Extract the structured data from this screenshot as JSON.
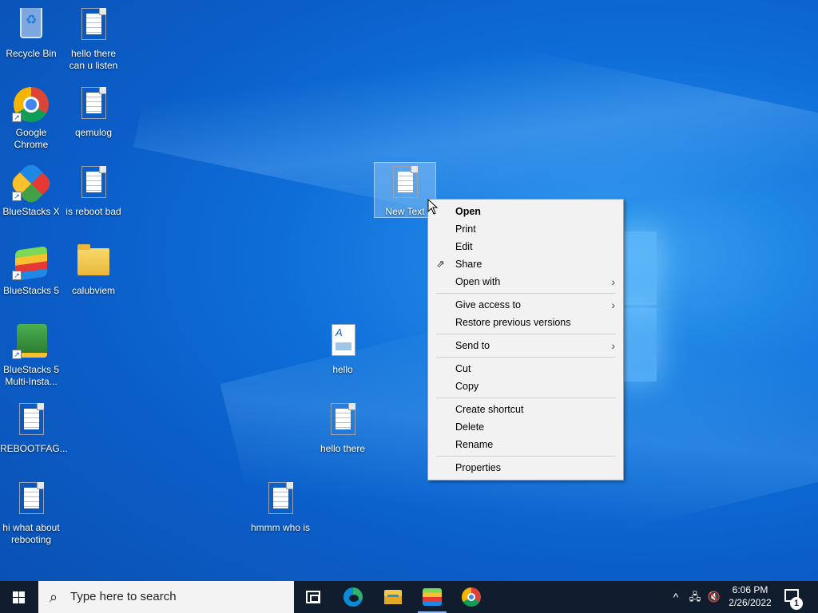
{
  "desktop": {
    "icons": [
      {
        "label": "Recycle Bin",
        "icon": "recycle-bin-icon"
      },
      {
        "label": "hello there can u listen",
        "icon": "text-file-icon"
      },
      {
        "label": "Google Chrome",
        "icon": "chrome-icon"
      },
      {
        "label": "qemulog",
        "icon": "text-file-icon"
      },
      {
        "label": "BlueStacks X",
        "icon": "bluestacks-x-icon"
      },
      {
        "label": "is reboot bad",
        "icon": "text-file-icon"
      },
      {
        "label": "BlueStacks 5",
        "icon": "bluestacks-5-icon"
      },
      {
        "label": "calubviem",
        "icon": "folder-icon"
      },
      {
        "label": "BlueStacks 5 Multi-Insta...",
        "icon": "bluestacks-multi-instance-icon"
      },
      {
        "label": "REBOOTFAG...",
        "icon": "text-file-icon"
      },
      {
        "label": "hi what about rebooting",
        "icon": "text-file-icon"
      },
      {
        "label": "hello",
        "icon": "wordpad-file-icon"
      },
      {
        "label": "hello there",
        "icon": "text-file-icon"
      },
      {
        "label": "hmmm who is",
        "icon": "text-file-icon"
      },
      {
        "label": "New Text",
        "icon": "text-file-icon",
        "selected": true
      }
    ]
  },
  "context_menu": {
    "items": [
      {
        "label": "Open",
        "bold": true
      },
      {
        "label": "Print"
      },
      {
        "label": "Edit"
      },
      {
        "label": "Share",
        "icon": "share-icon"
      },
      {
        "label": "Open with",
        "submenu": true
      },
      {
        "label": "Give access to",
        "submenu": true
      },
      {
        "label": "Restore previous versions"
      },
      {
        "label": "Send to",
        "submenu": true
      },
      {
        "label": "Cut"
      },
      {
        "label": "Copy"
      },
      {
        "label": "Create shortcut"
      },
      {
        "label": "Delete"
      },
      {
        "label": "Rename"
      },
      {
        "label": "Properties"
      }
    ]
  },
  "taskbar": {
    "search_placeholder": "Type here to search",
    "apps": [
      "task-view-icon",
      "edge-icon",
      "file-explorer-icon",
      "bluestacks-icon",
      "chrome-icon"
    ],
    "tray": {
      "time": "6:06 PM",
      "date": "2/26/2022",
      "notification_count": "1"
    }
  }
}
